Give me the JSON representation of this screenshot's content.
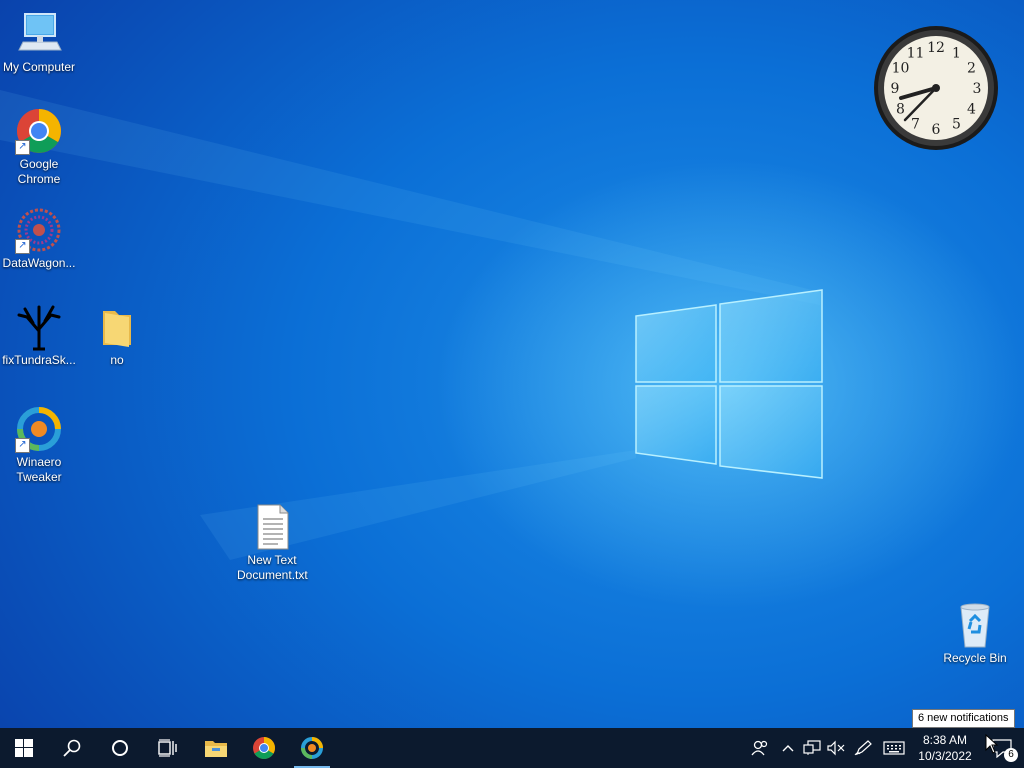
{
  "desktop": {
    "icons": [
      {
        "label": "My Computer"
      },
      {
        "label": "Google Chrome"
      },
      {
        "label": "DataWagon..."
      },
      {
        "label": "fixTundraSk..."
      },
      {
        "label": "no"
      },
      {
        "label": "Winaero Tweaker"
      },
      {
        "label": "New Text Document.txt"
      },
      {
        "label": "Recycle Bin"
      }
    ]
  },
  "clock": {
    "numbers": [
      "12",
      "1",
      "2",
      "3",
      "4",
      "5",
      "6",
      "7",
      "8",
      "9",
      "10",
      "11"
    ]
  },
  "taskbar": {
    "start_icon": "windows-logo-icon",
    "search_icon": "search-icon",
    "cortana_icon": "cortana-circle-icon",
    "task_view_icon": "task-view-icon",
    "pinned": [
      "file-explorer-icon",
      "chrome-icon",
      "winaero-tweaker-icon"
    ]
  },
  "tray": {
    "time": "8:38 AM",
    "date": "10/3/2022",
    "notification_count": "6",
    "tooltip": "6 new notifications"
  },
  "colors": {
    "accent": "#76b9ed",
    "taskbar": "#0c1a2e",
    "desktop": "#0b6fd6"
  }
}
